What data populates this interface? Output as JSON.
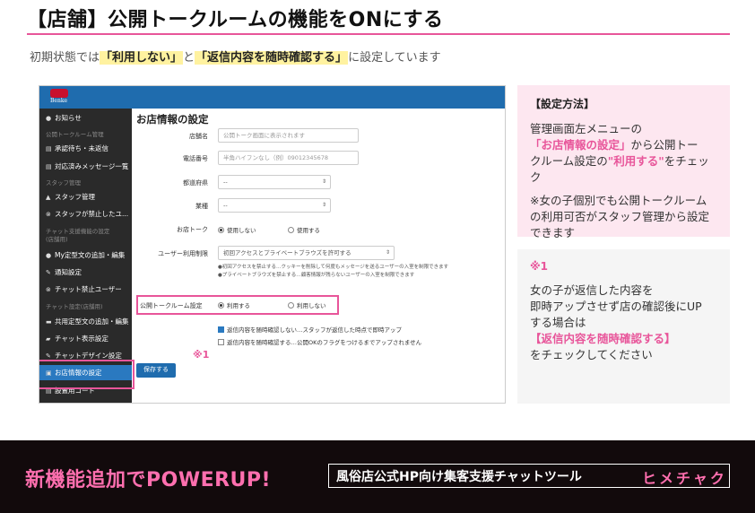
{
  "header": {
    "title": "【店舗】公開トークルームの機能をONにする",
    "intro_pre": "初期状態では",
    "intro_hl1": "「利用しない」",
    "intro_mid": "と",
    "intro_hl2": "「返信内容を随時確認する」",
    "intro_post": "に設定しています"
  },
  "shot": {
    "logo_text": "Benke",
    "sidebar": {
      "items": [
        {
          "label": "お知らせ",
          "icon": "info-icon"
        },
        {
          "label": "公開トークルーム管理",
          "category": true
        },
        {
          "label": "承認待ち・未返信",
          "icon": "list-icon"
        },
        {
          "label": "対応済みメッセージ一覧",
          "icon": "list-icon"
        },
        {
          "label": "スタッフ管理",
          "category": true
        },
        {
          "label": "スタッフ管理",
          "icon": "user-icon"
        },
        {
          "label": "スタッフが禁止したユ...",
          "icon": "block-icon"
        },
        {
          "label": "チャット支援機能の設定",
          "category": true
        },
        {
          "label": "(店舗用)",
          "category": true
        },
        {
          "label": "My定型文の追加・編集",
          "icon": "chat-icon"
        },
        {
          "label": "通知設定",
          "icon": "wrench-icon"
        },
        {
          "label": "チャット禁止ユーザー",
          "icon": "block-icon"
        },
        {
          "label": "チャット設定(店舗用)",
          "category": true
        },
        {
          "label": "共用定型文の追加・編集",
          "icon": "chat-icon"
        },
        {
          "label": "チャット表示設定",
          "icon": "tag-icon"
        },
        {
          "label": "チャットデザイン設定",
          "icon": "brush-icon"
        },
        {
          "label": "お店情報の設定",
          "icon": "shop-icon"
        },
        {
          "label": "設置用コード",
          "icon": "code-icon"
        }
      ]
    },
    "form": {
      "title": "お店情報の設定",
      "shop_name_label": "店舗名",
      "shop_name_placeholder": "公開トーク画面に表示されます",
      "phone_label": "電話番号",
      "phone_placeholder": "半角ハイフンなし（例）09012345678",
      "pref_label": "都道府県",
      "pref_value": "--",
      "industry_label": "業種",
      "industry_value": "--",
      "talk_label": "お店トーク",
      "talk_opt1": "使用しない",
      "talk_opt2": "使用する",
      "limit_label": "ユーザー利用制限",
      "limit_value": "初回アクセスとプライベートブラウズを許可する",
      "limit_note1": "●初回アクセスを禁止する…クッキーを削除して何度もメッセージを送るユーザーの入室を制限できます",
      "limit_note2": "●プライベートブラウズを禁止する…顧客情報が残らないユーザーの入室を制限できます",
      "public_label": "公開トークルーム設定",
      "public_opt1": "利用する",
      "public_opt2": "利用しない",
      "confirm_opt1": "返信内容を随時確認しない…スタッフが返信した時点で即時アップ",
      "confirm_opt2": "返信内容を随時確認する…公開OKのフラグをつけるまでアップされません",
      "mark": "※1",
      "save": "保存する"
    }
  },
  "panel_method": {
    "heading": "【設定方法】",
    "line1": "管理画面左メニューの",
    "line2_pink": "「お店情報の設定」",
    "line2_rest": "から公開トー",
    "line3_pre": "クルーム設定の",
    "line3_pink": "\"利用する\"",
    "line3_post": "をチェック",
    "line4": "※女の子個別でも公開トークルーム",
    "line5": "の利用可否がスタッフ管理から設定",
    "line6": "できます"
  },
  "panel_note": {
    "heading": "※1",
    "line1": "女の子が返信した内容を",
    "line2": "即時アップさせず店の確認後にUP",
    "line3": "する場合は",
    "line4_pink": "【返信内容を随時確認する】",
    "line5": "をチェックしてください"
  },
  "footer": {
    "title": "新機能追加でPOWERUP!",
    "subtitle": "風俗店公式HP向け集客支援チャットツール",
    "brand": "ヒメチャク"
  },
  "colors": {
    "accent_pink": "#e8559a",
    "bar_blue": "#1f6cae",
    "sidebar_dark": "#2a2a2a",
    "highlight_yellow": "#fff2a0"
  }
}
